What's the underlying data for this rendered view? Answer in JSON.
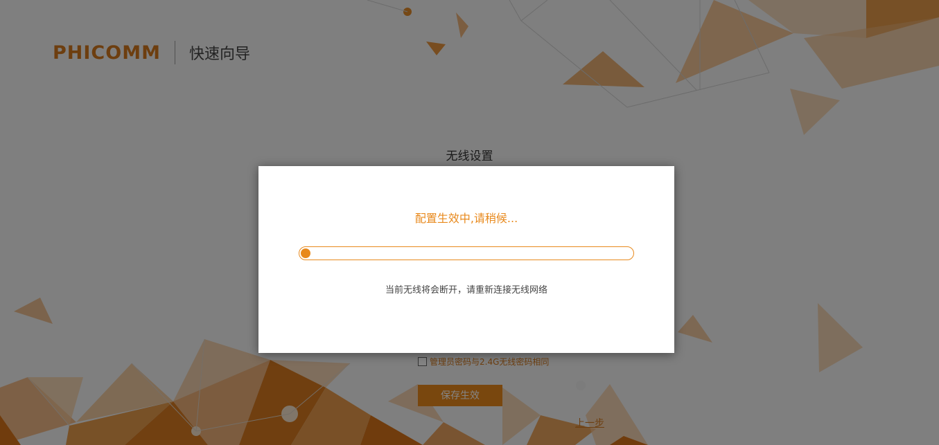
{
  "header": {
    "logo_text": "PHICOMM",
    "wizard_title": "快速向导"
  },
  "page": {
    "title": "无线设置"
  },
  "form": {
    "same_password_label": "管理员密码与2.4G无线密码相同",
    "same_password_checked": false,
    "save_label": "保存生效",
    "prev_label": "上一步"
  },
  "modal": {
    "message": "配置生效中,请稍候...",
    "progress_percent": 2,
    "note": "当前无线将会断开，请重新连接无线网络"
  },
  "colors": {
    "brand_orange": "#e8891c",
    "overlay": "rgba(0,0,0,0.48)"
  }
}
